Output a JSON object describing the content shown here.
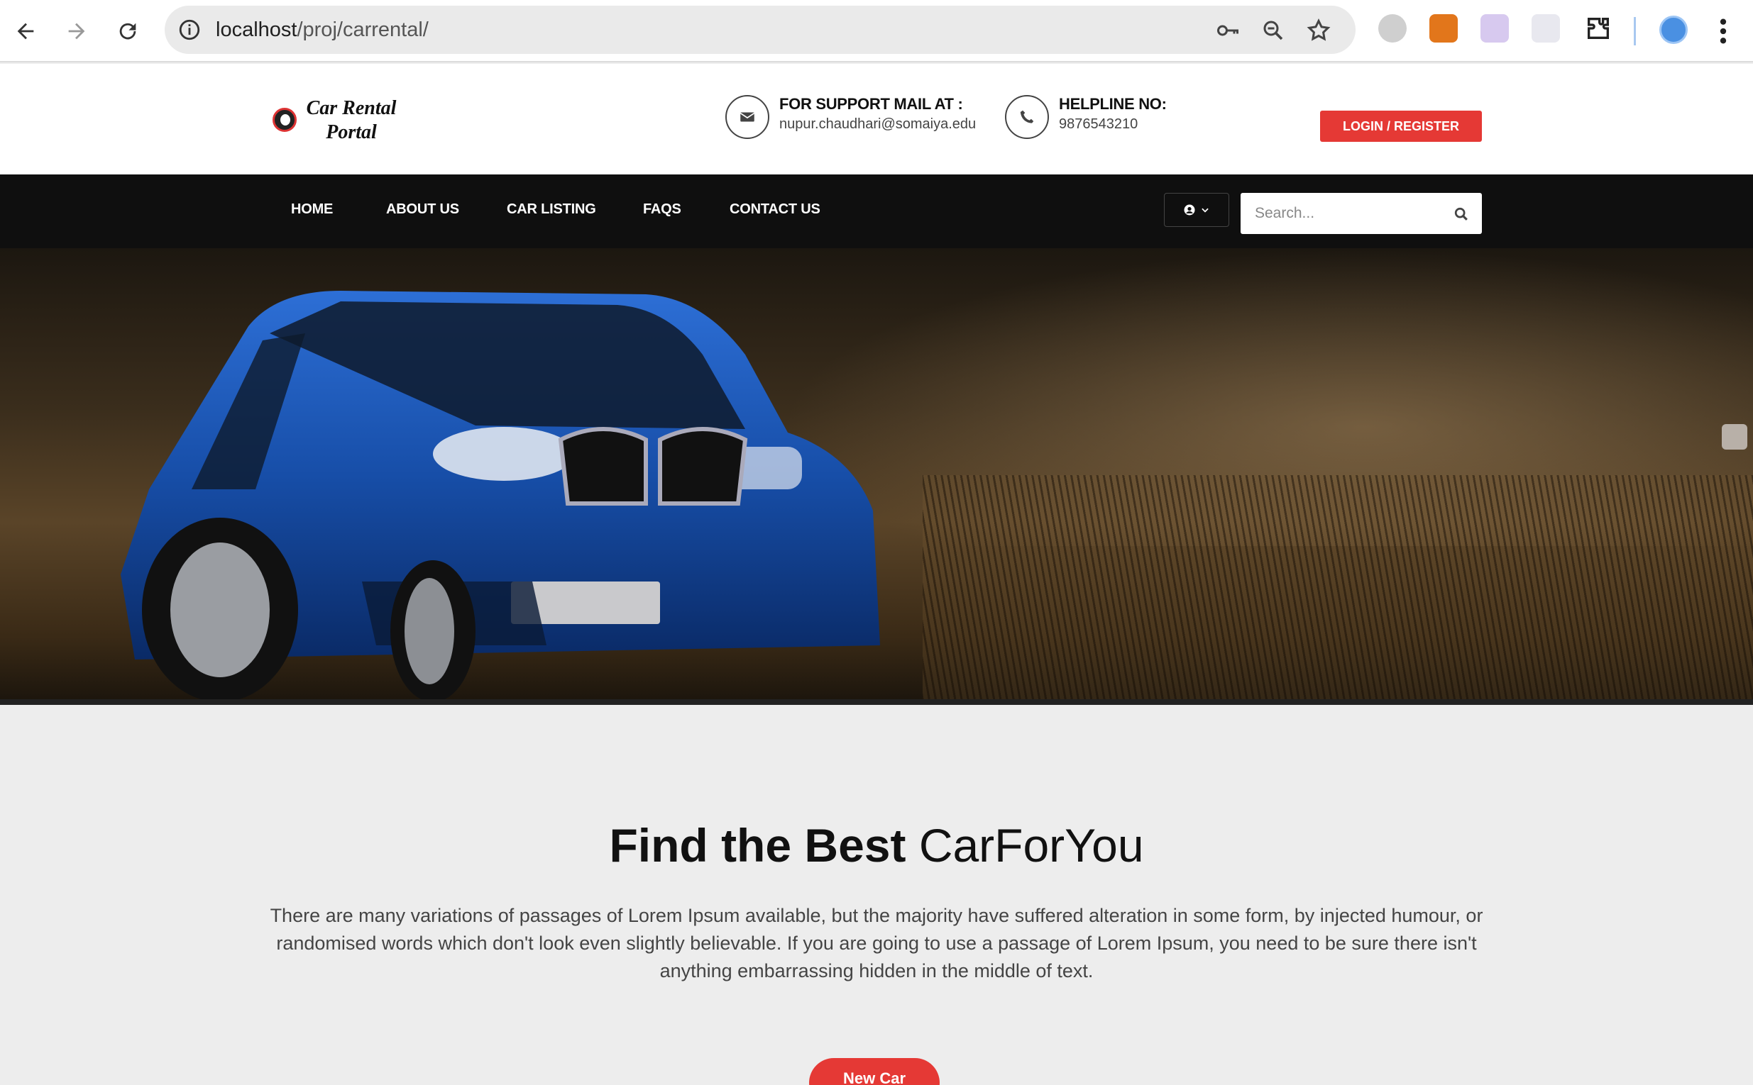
{
  "browser": {
    "url_host": "localhost",
    "url_path": "/proj/carrental/"
  },
  "header": {
    "logo_line1": "Car Rental",
    "logo_line2": "Portal",
    "support_title": "FOR SUPPORT MAIL AT :",
    "support_email": "nupur.chaudhari@somaiya.edu",
    "helpline_title": "HELPLINE NO:",
    "helpline_number": "9876543210",
    "login_label": "LOGIN / REGISTER"
  },
  "nav": {
    "items": [
      {
        "label": "HOME"
      },
      {
        "label": "ABOUT US"
      },
      {
        "label": "CAR LISTING"
      },
      {
        "label": "FAQS"
      },
      {
        "label": "CONTACT US"
      }
    ],
    "search_placeholder": "Search..."
  },
  "main": {
    "headline_bold": "Find the Best",
    "headline_light": "CarForYou",
    "paragraph": "There are many variations of passages of Lorem Ipsum available, but the majority have suffered alteration in some form, by injected humour, or randomised words which don't look even slightly believable. If you are going to use a passage of Lorem Ipsum, you need to be sure there isn't anything embarrassing hidden in the middle of text.",
    "new_car_label": "New Car"
  },
  "colors": {
    "accent": "#e53935",
    "navbar": "#0f0f0f",
    "page_bg": "#ededed"
  }
}
